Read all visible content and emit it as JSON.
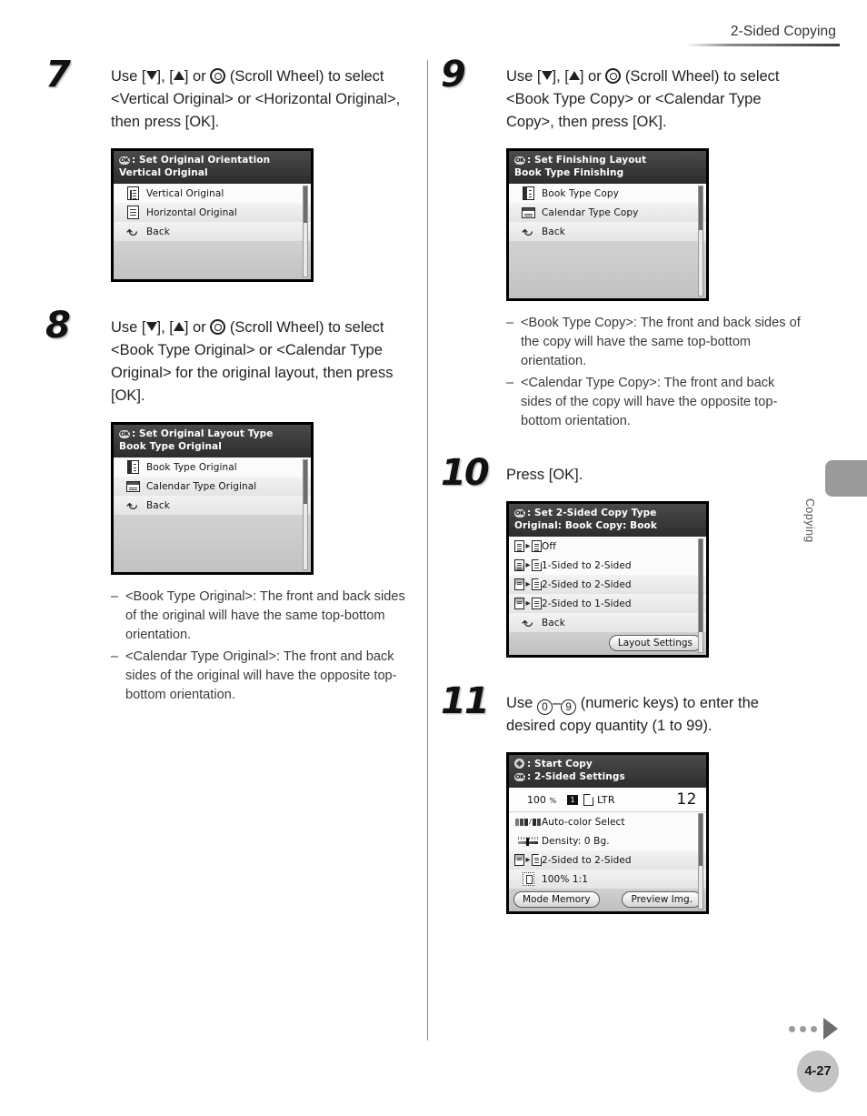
{
  "runhead": {
    "title": "2-Sided Copying"
  },
  "steps": [
    {
      "number": "7",
      "text_parts": {
        "p1": "Use [",
        "p2": "], [",
        "p3": "] or ",
        "p4": " (Scroll Wheel) to select <Vertical Original> or <Horizontal Original>, then press [OK]."
      },
      "panel": {
        "header_line1": ": Set Original Orientation",
        "header_line2": "Vertical Original",
        "rows": [
          {
            "label": "Vertical Original",
            "icon": "vertical-document-icon"
          },
          {
            "label": "Horizontal Original",
            "icon": "horizontal-document-icon"
          },
          {
            "label": "Back",
            "icon": "back-arrow-icon"
          }
        ]
      }
    },
    {
      "number": "8",
      "text_parts": {
        "p1": "Use [",
        "p2": "], [",
        "p3": "] or ",
        "p4": " (Scroll Wheel) to select <Book Type Original> or <Calendar Type Original> for the original layout, then press [OK]."
      },
      "panel": {
        "header_line1": ": Set Original Layout Type",
        "header_line2": "Book Type Original",
        "rows": [
          {
            "label": "Book Type Original",
            "icon": "book-type-icon"
          },
          {
            "label": "Calendar Type Original",
            "icon": "calendar-type-icon"
          },
          {
            "label": "Back",
            "icon": "back-arrow-icon"
          }
        ]
      },
      "notes": [
        "<Book Type Original>: The front and back sides of the original will have the same top-bottom orientation.",
        "<Calendar Type Original>: The front and back sides of the original will have the opposite top-bottom orientation."
      ]
    },
    {
      "number": "9",
      "text_parts": {
        "p1": "Use [",
        "p2": "], [",
        "p3": "] or ",
        "p4": " (Scroll Wheel) to select <Book Type Copy> or <Calendar Type Copy>, then press [OK]."
      },
      "panel": {
        "header_line1": ": Set Finishing Layout",
        "header_line2": "Book Type Finishing",
        "rows": [
          {
            "label": "Book Type Copy",
            "icon": "book-type-icon"
          },
          {
            "label": "Calendar Type Copy",
            "icon": "calendar-type-icon"
          },
          {
            "label": "Back",
            "icon": "back-arrow-icon"
          }
        ]
      },
      "notes": [
        "<Book Type Copy>: The front and back sides of the copy will have the same top-bottom orientation.",
        "<Calendar Type Copy>: The front and back sides of the copy will have the opposite top-bottom orientation."
      ]
    },
    {
      "number": "10",
      "text": "Press [OK].",
      "panel": {
        "header_line1": ": Set 2-Sided Copy Type",
        "header_line2": "Original: Book Copy: Book",
        "rows": [
          {
            "label": "Off",
            "icon": "one-to-one-sided-icon"
          },
          {
            "label": "1-Sided to 2-Sided",
            "icon": "one-to-two-sided-icon"
          },
          {
            "label": "2-Sided to 2-Sided",
            "icon": "two-to-two-sided-icon"
          },
          {
            "label": "2-Sided to 1-Sided",
            "icon": "two-to-one-sided-icon"
          },
          {
            "label": "Back",
            "icon": "back-arrow-icon"
          }
        ],
        "buttons": [
          "Layout Settings"
        ]
      }
    },
    {
      "number": "11",
      "text_parts": {
        "p1": "Use ",
        "k1": "0",
        "p2": "–",
        "k2": "9",
        "p3": " (numeric keys) to enter the desired copy quantity (1 to 99)."
      },
      "panel": {
        "header_line1": ": Start Copy",
        "header_line2": ": 2-Sided Settings",
        "status": {
          "zoom": "100",
          "zoom_unit": "%",
          "tray": "1",
          "paper_size": "LTR",
          "quantity": "12"
        },
        "rows": [
          {
            "label": "Auto-color Select",
            "icon": "color-select-icon"
          },
          {
            "label": "Density: 0 Bg.",
            "icon": "density-slider-icon"
          },
          {
            "label": "2-Sided to 2-Sided",
            "icon": "two-to-two-sided-icon"
          },
          {
            "label": "100%  1:1",
            "icon": "zoom-ratio-icon"
          }
        ],
        "buttons": [
          "Mode Memory",
          "Preview Img."
        ]
      }
    }
  ],
  "sidetab": {
    "label": "Copying"
  },
  "footer": {
    "page_number": "4-27"
  }
}
